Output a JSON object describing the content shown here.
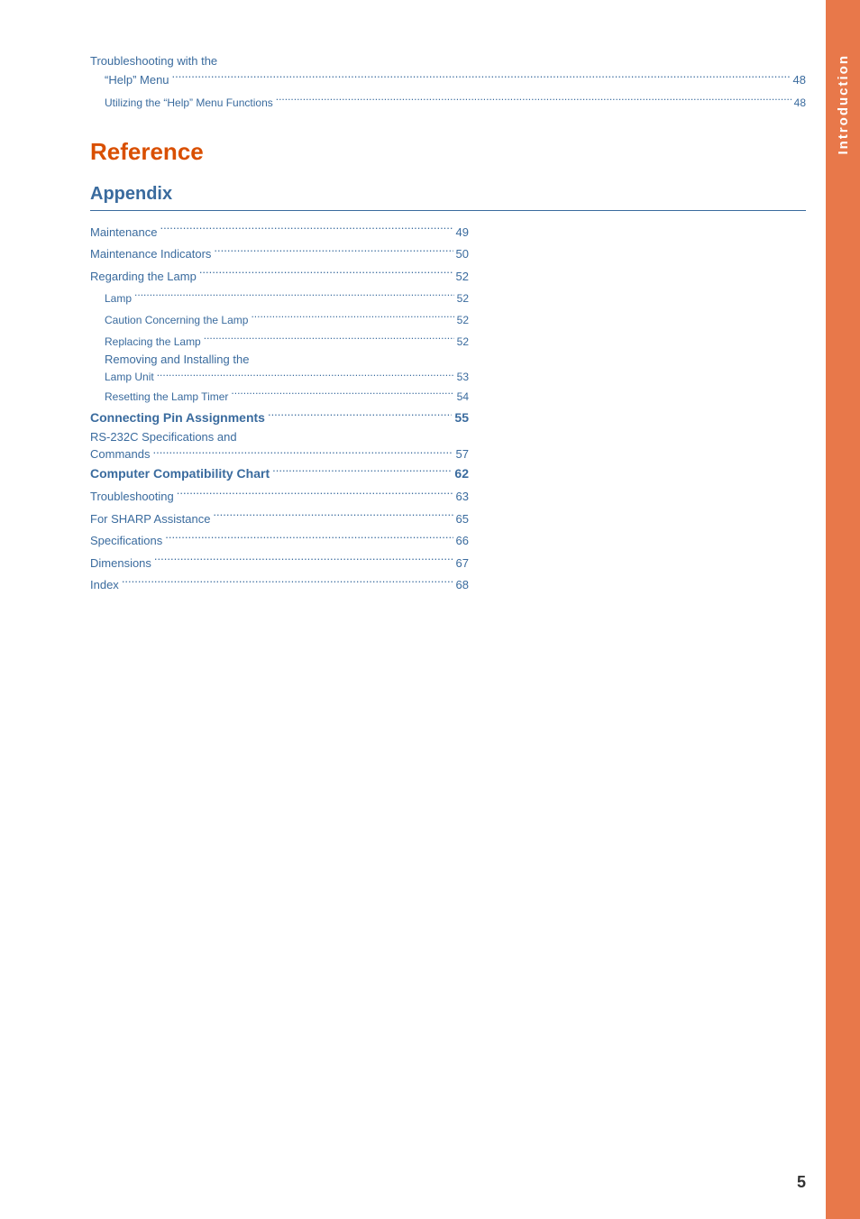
{
  "sidebar": {
    "label": "Introduction",
    "color": "#e8784a"
  },
  "page_number": "5",
  "sections": {
    "troubleshooting_header": {
      "line1": "Troubleshooting with the",
      "line2_label": "“Help” Menu",
      "line2_dots": ".....................................",
      "line2_page": "48",
      "line3_label": "Utilizing the “Help” Menu Functions",
      "line3_dots": "....",
      "line3_page": "48"
    },
    "reference_heading": "Reference",
    "appendix_heading": "Appendix",
    "toc_entries": [
      {
        "indent": 0,
        "bold": false,
        "label": "Maintenance",
        "dots": true,
        "page": "49"
      },
      {
        "indent": 0,
        "bold": false,
        "label": "Maintenance Indicators",
        "dots": true,
        "page": "50"
      },
      {
        "indent": 0,
        "bold": false,
        "label": "Regarding the Lamp",
        "dots": true,
        "page": "52"
      },
      {
        "indent": 1,
        "bold": false,
        "small": true,
        "label": "Lamp",
        "dots": true,
        "page": "52"
      },
      {
        "indent": 1,
        "bold": false,
        "small": true,
        "label": "Caution Concerning the Lamp",
        "dots": true,
        "page": "52"
      },
      {
        "indent": 1,
        "bold": false,
        "small": true,
        "label": "Replacing the Lamp",
        "dots": true,
        "page": "52"
      },
      {
        "indent": 1,
        "bold": false,
        "small": true,
        "multiline": true,
        "label": "Removing and Installing the",
        "label2": "Lamp Unit",
        "dots": true,
        "page": "53"
      },
      {
        "indent": 1,
        "bold": false,
        "small": true,
        "label": "Resetting the Lamp Timer",
        "dots": true,
        "page": "54"
      },
      {
        "indent": 0,
        "bold": true,
        "label": "Connecting Pin Assignments",
        "dots": true,
        "page": "55"
      },
      {
        "indent": 0,
        "bold": false,
        "multiline_label": true,
        "label": "RS-232C Specifications and",
        "label2": "Commands",
        "dots": true,
        "page": "57"
      },
      {
        "indent": 0,
        "bold": true,
        "label": "Computer Compatibility Chart",
        "dots": true,
        "page": "62"
      },
      {
        "indent": 0,
        "bold": false,
        "label": "Troubleshooting",
        "dots": true,
        "page": "63"
      },
      {
        "indent": 0,
        "bold": false,
        "label": "For SHARP Assistance",
        "dots": true,
        "page": "65"
      },
      {
        "indent": 0,
        "bold": false,
        "label": "Specifications",
        "dots": true,
        "page": "66"
      },
      {
        "indent": 0,
        "bold": false,
        "label": "Dimensions",
        "dots": true,
        "page": "67"
      },
      {
        "indent": 0,
        "bold": false,
        "label": "Index",
        "dots": true,
        "page": "68"
      }
    ]
  }
}
